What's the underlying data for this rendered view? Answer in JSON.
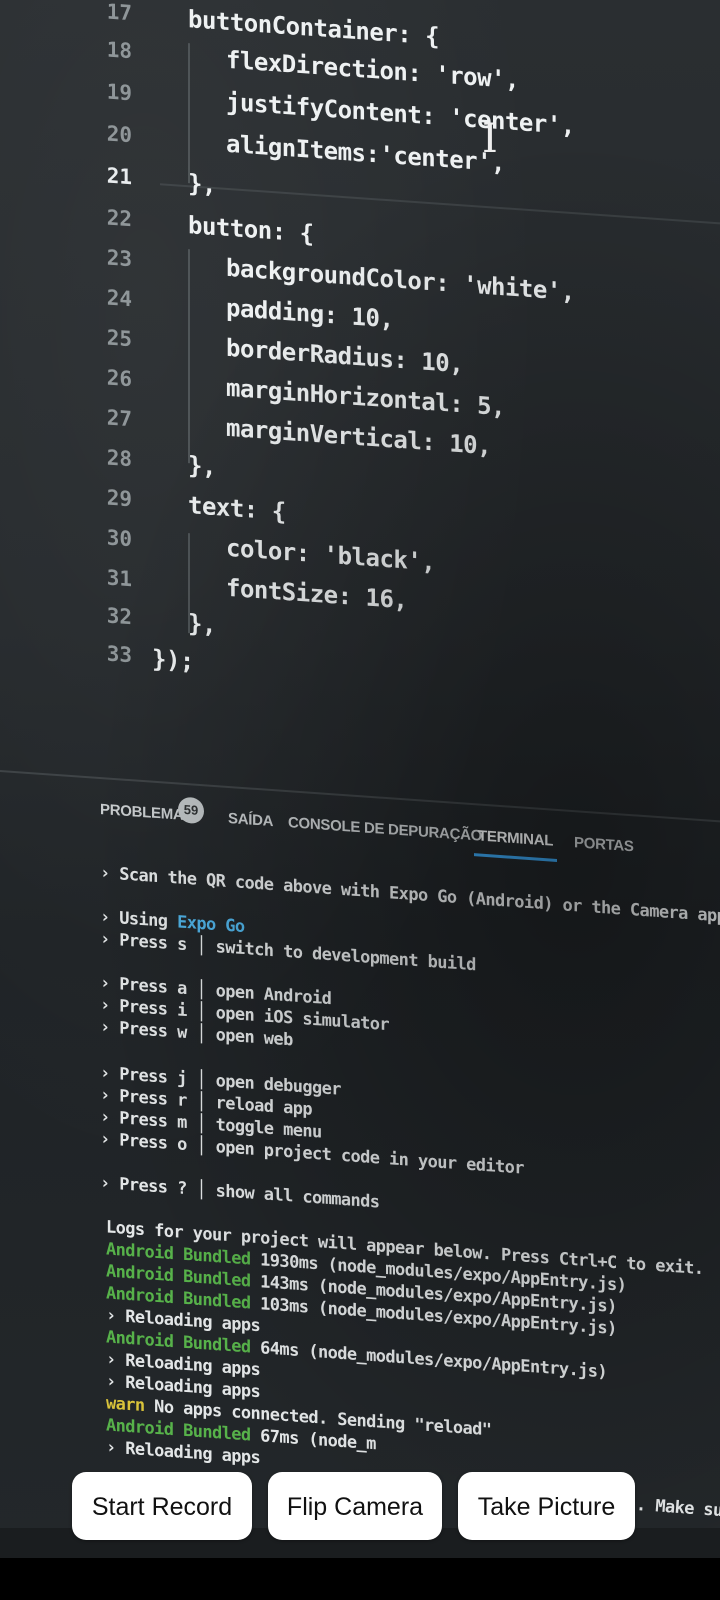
{
  "editor": {
    "lines": [
      {
        "n": "17",
        "text": "buttonContainer: {"
      },
      {
        "n": "18",
        "text": "flexDirection: 'row',"
      },
      {
        "n": "19",
        "text": "justifyContent: 'center',"
      },
      {
        "n": "20",
        "text": "alignItems:'center',"
      },
      {
        "n": "21",
        "text": "},"
      },
      {
        "n": "22",
        "text": "button: {"
      },
      {
        "n": "23",
        "text": "backgroundColor: 'white',"
      },
      {
        "n": "24",
        "text": "padding: 10,"
      },
      {
        "n": "25",
        "text": "borderRadius: 10,"
      },
      {
        "n": "26",
        "text": "marginHorizontal: 5,"
      },
      {
        "n": "27",
        "text": "marginVertical: 10,"
      },
      {
        "n": "28",
        "text": "},"
      },
      {
        "n": "29",
        "text": "text: {"
      },
      {
        "n": "30",
        "text": "color: 'black',"
      },
      {
        "n": "31",
        "text": "fontSize: 16,"
      },
      {
        "n": "32",
        "text": "},"
      },
      {
        "n": "33",
        "text": "});"
      }
    ]
  },
  "panel": {
    "tabs": [
      "PROBLEMAS",
      "SAÍDA",
      "CONSOLE DE DEPURAÇÃO",
      "TERMINAL",
      "PORTAS"
    ],
    "problems_count": "59",
    "active_tab": "TERMINAL"
  },
  "terminal": {
    "scan": "› Scan the QR code above with Expo Go (Android) or the Camera app (iOS)",
    "using_prefix": "› Using ",
    "using_link": "Expo Go",
    "press_s": "› Press s │ switch to development build",
    "press_a": "› Press a │ open Android",
    "press_i": "› Press i │ open iOS simulator",
    "press_w": "› Press w │ open web",
    "press_j": "› Press j │ open debugger",
    "press_r": "› Press r │ reload app",
    "press_m": "› Press m │ toggle menu",
    "press_o": "› Press o │ open project code in your editor",
    "press_q": "› Press ? │ show all commands",
    "logs": "Logs for your project will appear below. Press Ctrl+C to exit.",
    "bundled_label": "Android Bundled",
    "b1": " 1930ms (node_modules/expo/AppEntry.js)",
    "b2": " 143ms (node_modules/expo/AppEntry.js)",
    "b3": " 103ms (node_modules/expo/AppEntry.js)",
    "reloading": "› Reloading apps",
    "b4": " 64ms (node_modules/expo/AppEntry.js)",
    "warn_label": "warn",
    "warn_text": " No apps connected. Sending \"reload\"",
    "b5": " 67ms (node_m",
    "reloading_cut": "› Reloading apps",
    "make_sure": ". Make su"
  },
  "camera_controls": {
    "start_record": "Start Record",
    "flip_camera": "Flip Camera",
    "take_picture": "Take Picture"
  }
}
